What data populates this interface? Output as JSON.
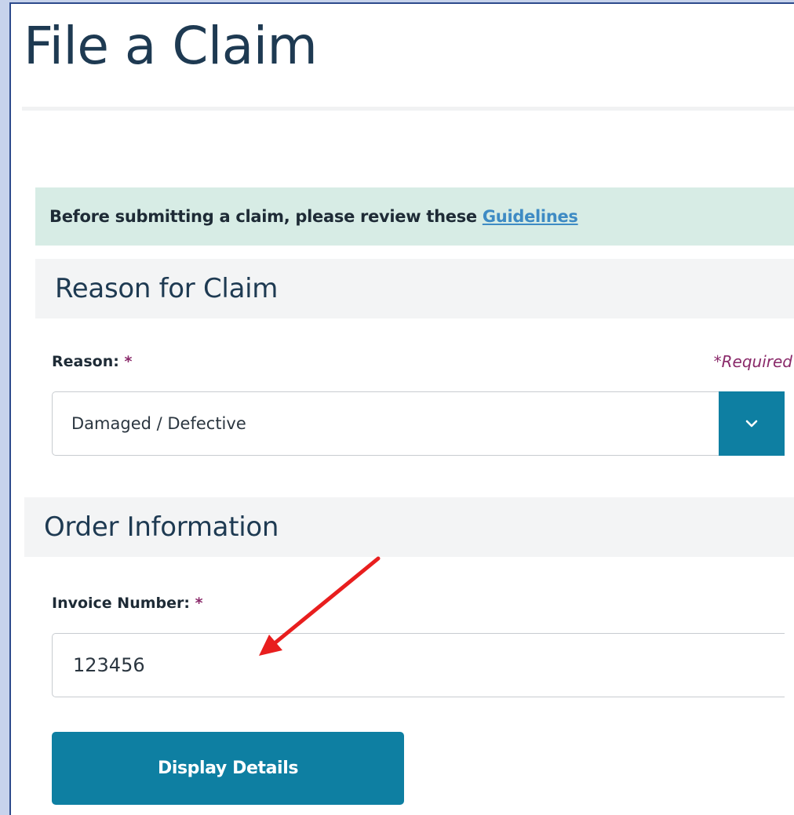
{
  "page": {
    "title": "File a Claim"
  },
  "notice": {
    "text": "Before submitting a claim, please review these ",
    "link_label": "Guidelines"
  },
  "reason_section": {
    "title": "Reason for Claim",
    "field_label": "Reason:",
    "required_marker": "*",
    "required_note": "*Required",
    "selected_value": "Damaged / Defective",
    "toggle_icon": "chevron-down-icon"
  },
  "order_section": {
    "title": "Order Information",
    "invoice_label": "Invoice Number:",
    "required_marker": "*",
    "invoice_value": "123456"
  },
  "actions": {
    "display_details_label": "Display Details"
  },
  "colors": {
    "accent": "#0e7fa2",
    "title_text": "#1e3a52",
    "notice_background": "#d7ece5",
    "link": "#3e8bc4",
    "required": "#8a2a6a",
    "annotation_arrow": "#e81e1e"
  }
}
